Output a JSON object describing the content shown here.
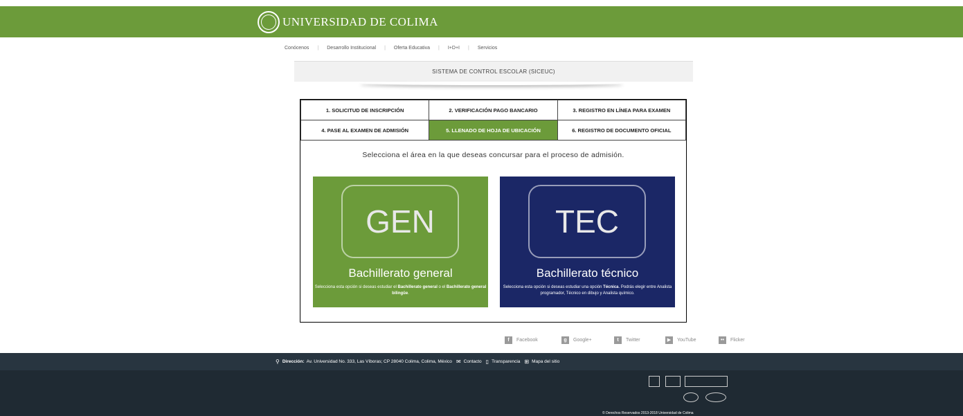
{
  "header": {
    "brand": "UNIVERSIDAD DE COLIMA"
  },
  "nav": {
    "items": [
      "Conócenos",
      "Desarrollo Institucional",
      "Oferta Educativa",
      "I+D+I",
      "Servicios"
    ]
  },
  "system_title": "SISTEMA DE CONTROL ESCOLAR (SICEUC)",
  "steps": [
    [
      "1. SOLICITUD DE INSCRIPCIÓN",
      "2. VERIFICACIÓN PAGO BANCARIO",
      "3. REGISTRO EN LÍNEA PARA EXAMEN"
    ],
    [
      "4. PASE AL EXAMEN DE ADMISIÓN",
      "5. LLENADO DE HOJA DE UBICACIÓN",
      "6. REGISTRO DE DOCUMENTO OFICIAL"
    ]
  ],
  "active_step": "5. LLENADO DE HOJA DE UBICACIÓN",
  "prompt": "Selecciona el área en la que deseas concursar para el proceso de admisión.",
  "cards": {
    "gen": {
      "code": "GEN",
      "title": "Bachillerato general",
      "desc_1": "Selecciona esta opción si deseas estudiar el ",
      "desc_b1": "Bachillerato general",
      "desc_2": " o el ",
      "desc_b2": "Bachillerato general bilingüe",
      "desc_3": ".",
      "color": "#6c9b3a"
    },
    "tec": {
      "code": "TEC",
      "title": "Bachillerato técnico",
      "desc_1": "Selecciona esta opción si deseas estudiar una opción ",
      "desc_b1": "Técnica",
      "desc_2": ". Podrás elegir entre Analista programador, Técnico en dibujo y Analista químico.",
      "color": "#1b2766"
    }
  },
  "social": [
    "Facebook",
    "Google+",
    "Twitter",
    "YouTube",
    "Flicker"
  ],
  "footer": {
    "address_label": "Dirección:",
    "address": "Av. Universidad No. 333, Las Víboras; CP 28040 Colima, Colima, México",
    "contact": "Contacto",
    "transparency": "Transparencia",
    "sitemap": "Mapa del sitio",
    "copyright": "© Derechos Reservados 2013-2018 Universidad de Colima"
  },
  "colors": {
    "brand_green": "#6c9b3a",
    "navy": "#1b2766",
    "footer_bg": "#1f2a33"
  }
}
